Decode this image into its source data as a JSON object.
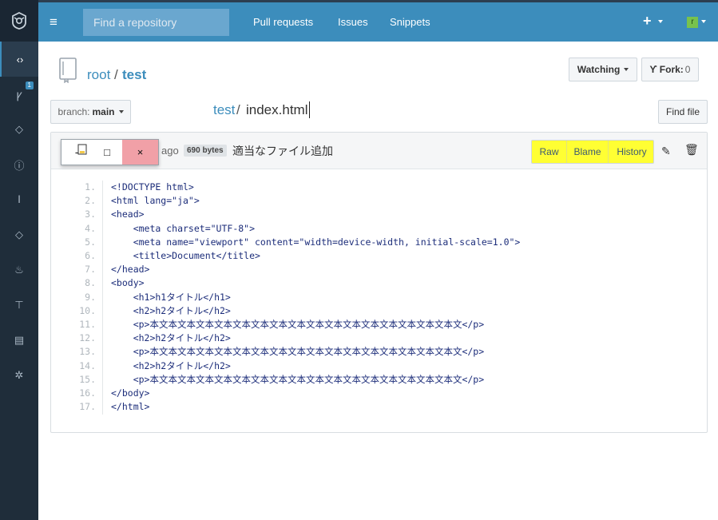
{
  "sidebar": {
    "badge": "1",
    "items": [
      "code-icon",
      "merge-icon",
      "tag-icon",
      "issue-icon",
      "pull-icon",
      "label-icon",
      "flame-icon",
      "pin-icon",
      "book-icon",
      "gear-icon"
    ]
  },
  "topbar": {
    "search_placeholder": "Find a repository",
    "links": [
      "Pull requests",
      "Issues",
      "Snippets"
    ],
    "plus": "+",
    "avatar": "r"
  },
  "repo": {
    "owner": "root",
    "separator": "/",
    "name": "test",
    "watch_label": "Watching",
    "fork_label": "Fork:",
    "fork_count": "0"
  },
  "file_path": {
    "branch_prefix": "branch:",
    "branch": "main",
    "repo": "test",
    "separator": "/",
    "file": "index.html",
    "find_file": "Find file"
  },
  "file_header": {
    "ago": "ago",
    "size": "690 bytes",
    "commit_message": "適当なファイル追加",
    "raw": "Raw",
    "blame": "Blame",
    "history": "History"
  },
  "code_lines": [
    {
      "n": "1.",
      "t": "<!DOCTYPE html>"
    },
    {
      "n": "2.",
      "t": "<html lang=\"ja\">"
    },
    {
      "n": "3.",
      "t": "<head>"
    },
    {
      "n": "4.",
      "t": "    <meta charset=\"UTF-8\">"
    },
    {
      "n": "5.",
      "t": "    <meta name=\"viewport\" content=\"width=device-width, initial-scale=1.0\">"
    },
    {
      "n": "6.",
      "t": "    <title>Document</title>"
    },
    {
      "n": "7.",
      "t": "</head>"
    },
    {
      "n": "8.",
      "t": "<body>"
    },
    {
      "n": "9.",
      "t": "    <h1>h1タイトル</h1>"
    },
    {
      "n": "10.",
      "t": "    <h2>h2タイトル</h2>"
    },
    {
      "n": "11.",
      "t": "    <p>本文本文本文本文本文本文本文本文本文本文本文本文本文本文本文本文本文</p>"
    },
    {
      "n": "12.",
      "t": "    <h2>h2タイトル</h2>"
    },
    {
      "n": "13.",
      "t": "    <p>本文本文本文本文本文本文本文本文本文本文本文本文本文本文本文本文本文</p>"
    },
    {
      "n": "14.",
      "t": "    <h2>h2タイトル</h2>"
    },
    {
      "n": "15.",
      "t": "    <p>本文本文本文本文本文本文本文本文本文本文本文本文本文本文本文本文本文</p>"
    },
    {
      "n": "16.",
      "t": "</body>"
    },
    {
      "n": "17.",
      "t": "</html>"
    }
  ],
  "window_popup": {
    "minimize": "-",
    "maximize": "□",
    "close": "×"
  },
  "colors": {
    "topbar": "#3c8dbc",
    "sidebar": "#1f2d3a",
    "highlight": "#ffff33",
    "close_bg": "#f1a0a7"
  }
}
